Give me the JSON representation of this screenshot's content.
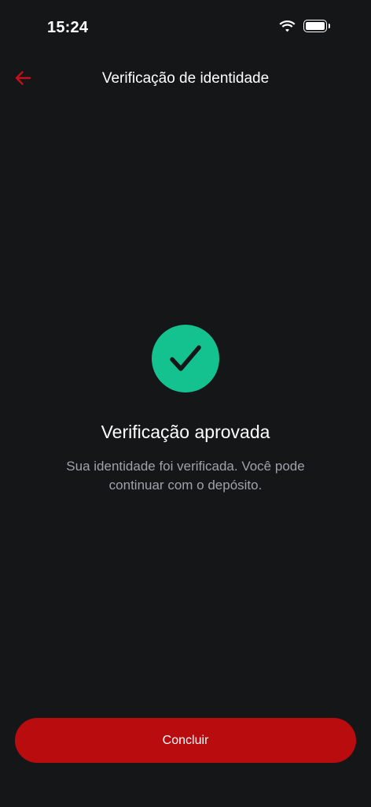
{
  "status_bar": {
    "time": "15:24",
    "icons": [
      "wifi-icon",
      "battery-icon"
    ]
  },
  "header": {
    "back_icon": "arrow-left-icon",
    "title": "Verificação de identidade"
  },
  "result": {
    "icon": "check-circle-icon",
    "title": "Verificação aprovada",
    "message": "Sua identidade foi verificada. Você pode continuar com o depósito."
  },
  "actions": {
    "primary_label": "Concluir"
  },
  "colors": {
    "background": "#151618",
    "accent": "#b90c0f",
    "success": "#13c28e",
    "back_arrow": "#c4101a",
    "secondary_text": "#a0a2a8"
  }
}
